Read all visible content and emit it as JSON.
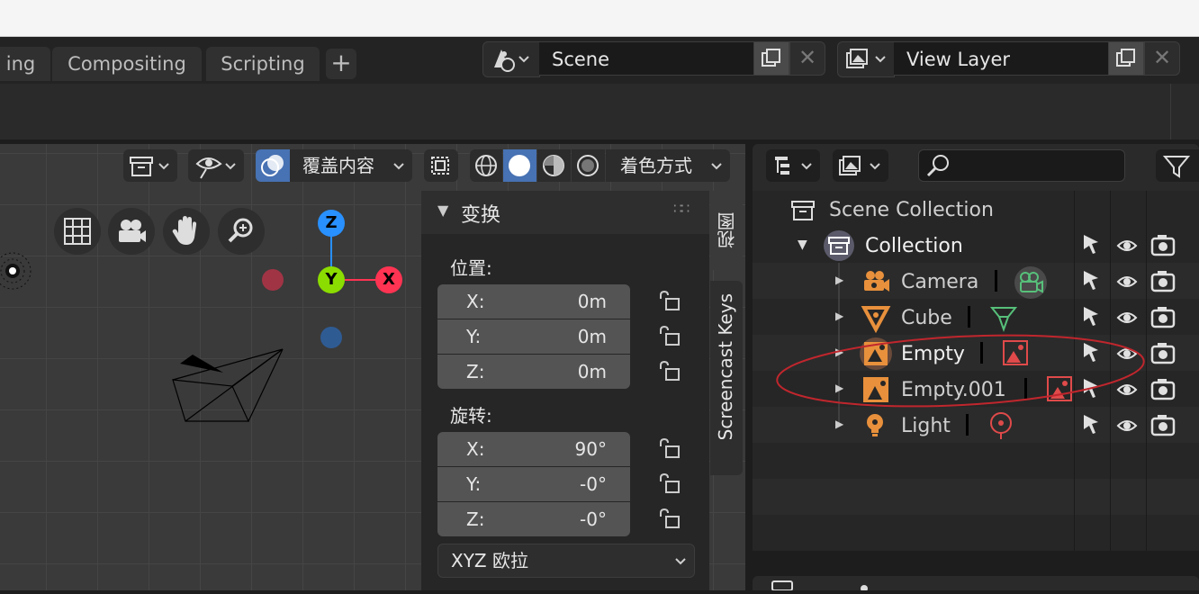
{
  "workspace_tabs": {
    "partial": "ing",
    "compositing": "Compositing",
    "scripting": "Scripting",
    "add": "+"
  },
  "scene_selector": {
    "value": "Scene"
  },
  "view_layer_selector": {
    "value": "View Layer"
  },
  "viewport": {
    "overlay_label": "覆盖内容",
    "shading_label": "着色方式",
    "gizmo": {
      "z": "Z",
      "y": "Y",
      "x": "X"
    }
  },
  "transform_panel": {
    "title": "变换",
    "location_label": "位置:",
    "location": [
      {
        "axis": "X:",
        "value": "0m"
      },
      {
        "axis": "Y:",
        "value": "0m"
      },
      {
        "axis": "Z:",
        "value": "0m"
      }
    ],
    "rotation_label": "旋转:",
    "rotation": [
      {
        "axis": "X:",
        "value": "90°"
      },
      {
        "axis": "Y:",
        "value": "-0°"
      },
      {
        "axis": "Z:",
        "value": "-0°"
      }
    ],
    "rotation_mode": "XYZ 欧拉"
  },
  "side_tabs": {
    "view": "视图",
    "screencast": "Screencast Keys"
  },
  "outliner": {
    "scene_collection": "Scene Collection",
    "collection": "Collection",
    "items": [
      {
        "name": "Camera",
        "icon": "camera-icon",
        "data_icon": "camera-data-icon"
      },
      {
        "name": "Cube",
        "icon": "mesh-object-icon",
        "data_icon": "mesh-data-icon"
      },
      {
        "name": "Empty",
        "icon": "image-empty-icon",
        "data_icon": "image-data-icon"
      },
      {
        "name": "Empty.001",
        "icon": "image-empty-icon",
        "data_icon": "image-data-icon"
      },
      {
        "name": "Light",
        "icon": "light-icon",
        "data_icon": "light-data-icon"
      }
    ]
  },
  "colors": {
    "accent_blue": "#4772b3",
    "axis_x": "#ff3352",
    "axis_y": "#8bdc00",
    "axis_z": "#2890ff",
    "object_orange": "#e8903c",
    "annotation_red": "#c0262d"
  }
}
